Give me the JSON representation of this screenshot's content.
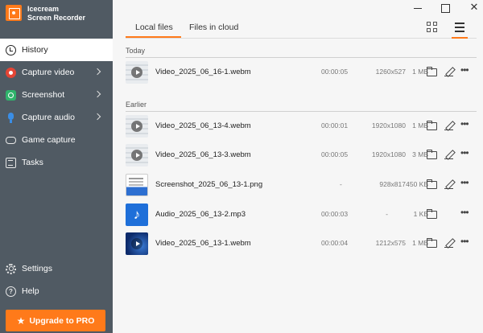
{
  "app": {
    "name_line1": "Icecream",
    "name_line2": "Screen Recorder",
    "accent": "#ff7a1a",
    "sidebar_bg": "#505a63"
  },
  "window": {
    "minimize": "—",
    "maximize": "☐",
    "close": "✕"
  },
  "sidebar": {
    "items": [
      {
        "label": "History",
        "icon": "clock-icon",
        "active": true
      },
      {
        "label": "Capture video",
        "icon": "record-icon",
        "has_submenu": true
      },
      {
        "label": "Screenshot",
        "icon": "camera-icon",
        "has_submenu": true
      },
      {
        "label": "Capture audio",
        "icon": "microphone-icon",
        "has_submenu": true
      },
      {
        "label": "Game capture",
        "icon": "gamepad-icon"
      },
      {
        "label": "Tasks",
        "icon": "tasks-icon"
      }
    ],
    "bottom": [
      {
        "label": "Settings",
        "icon": "gear-icon"
      },
      {
        "label": "Help",
        "icon": "help-icon"
      }
    ],
    "upgrade_label": "Upgrade to PRO"
  },
  "tabs": [
    {
      "label": "Local files",
      "active": true
    },
    {
      "label": "Files in cloud",
      "active": false
    }
  ],
  "view_mode": "list",
  "sections": [
    {
      "label": "Today",
      "files": [
        {
          "name": "Video_2025_06_16-1.webm",
          "type": "video",
          "duration": "00:00:05",
          "resolution": "1260x527",
          "size": "1 MB",
          "editable": true
        }
      ]
    },
    {
      "label": "Earlier",
      "files": [
        {
          "name": "Video_2025_06_13-4.webm",
          "type": "video",
          "duration": "00:00:01",
          "resolution": "1920x1080",
          "size": "1 MB",
          "editable": true
        },
        {
          "name": "Video_2025_06_13-3.webm",
          "type": "video",
          "duration": "00:00:05",
          "resolution": "1920x1080",
          "size": "3 MB",
          "editable": true
        },
        {
          "name": "Screenshot_2025_06_13-1.png",
          "type": "screenshot",
          "duration": "-",
          "resolution": "928x817",
          "size": "450 KB",
          "editable": true
        },
        {
          "name": "Audio_2025_06_13-2.mp3",
          "type": "audio",
          "duration": "00:00:03",
          "resolution": "-",
          "size": "1 KB",
          "editable": false
        },
        {
          "name": "Video_2025_06_13-1.webm",
          "type": "video-desktop",
          "duration": "00:00:04",
          "resolution": "1212x575",
          "size": "1 MB",
          "editable": true
        }
      ]
    }
  ]
}
